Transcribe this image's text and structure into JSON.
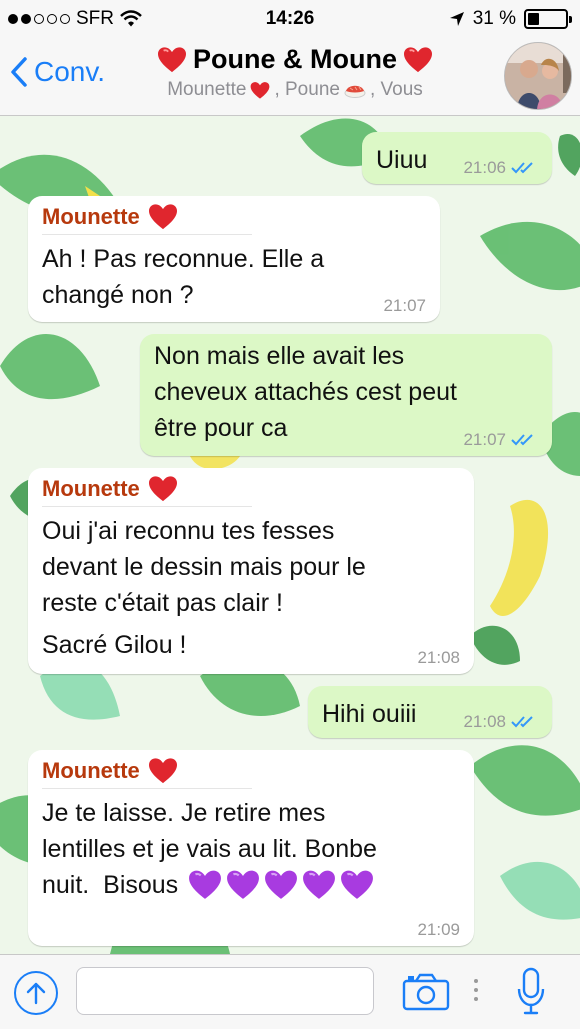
{
  "status_bar": {
    "carrier": "SFR",
    "time": "14:26",
    "battery_percent": "31 %",
    "battery_level": 0.31
  },
  "nav": {
    "back_label": "Conv.",
    "title": "Poune & Moune",
    "subtitle_part1": "Mounette",
    "subtitle_part2": ", Poune",
    "subtitle_part3": ", Vous"
  },
  "messages": [
    {
      "direction": "out",
      "text": "Uiuu",
      "time": "21:06",
      "read": true
    },
    {
      "direction": "in",
      "sender": "Mounette",
      "lines": [
        "Ah ! Pas reconnue. Elle a",
        "changé non ?"
      ],
      "time": "21:07"
    },
    {
      "direction": "out",
      "lines": [
        "Non mais elle avait les",
        "cheveux attachés cest peut",
        "être pour ca"
      ],
      "time": "21:07",
      "read": true
    },
    {
      "direction": "in",
      "sender": "Mounette",
      "lines": [
        "Oui j'ai reconnu tes fesses",
        "devant le dessin mais pour le",
        "reste c'était pas clair !"
      ],
      "extra": "Sacré Gilou !",
      "time": "21:08"
    },
    {
      "direction": "out",
      "text": "Hihi ouiii",
      "time": "21:08",
      "read": true
    },
    {
      "direction": "in",
      "sender": "Mounette",
      "lines": [
        "Je te laisse. Je retire mes",
        "lentilles et je vais au lit. Bonbe"
      ],
      "last_line": "nuit.  Bisous",
      "time": "21:09"
    }
  ],
  "input": {
    "placeholder": "",
    "value": ""
  },
  "colors": {
    "accent": "#1a7ef7",
    "sender_name": "#b7390d",
    "outgoing_bubble": "#dcf8c6",
    "incoming_bubble": "#ffffff",
    "read_ticks": "#3497f9"
  },
  "icons": [
    "back-chevron-icon",
    "heart-icon",
    "sushi-icon",
    "upload-icon",
    "camera-icon",
    "microphone-icon",
    "purple-heart-icon",
    "double-check-icon"
  ]
}
